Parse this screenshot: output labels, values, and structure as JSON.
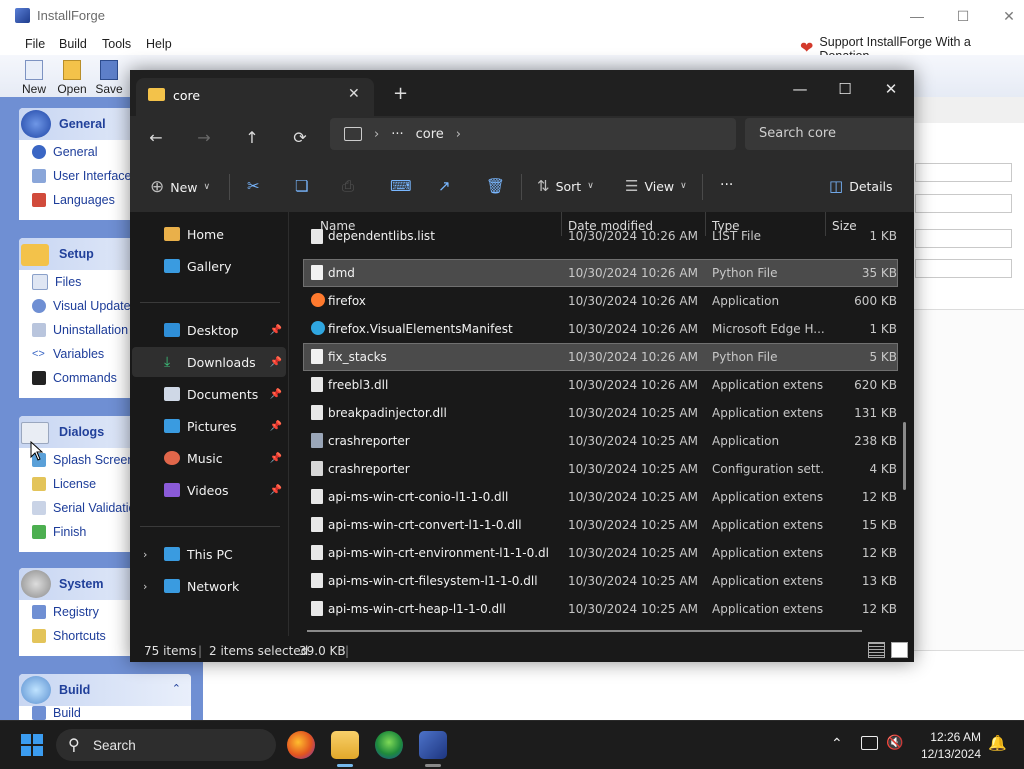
{
  "installforge": {
    "title": "InstallForge",
    "menu": [
      "File",
      "Build",
      "Tools",
      "Help"
    ],
    "donation": "Support InstallForge With a Donation",
    "toolbar": [
      "New",
      "Open",
      "Save"
    ],
    "groups": [
      {
        "title": "General",
        "items": [
          "General",
          "User Interface",
          "Languages"
        ]
      },
      {
        "title": "Setup",
        "items": [
          "Files",
          "Visual Update",
          "Uninstallation",
          "Variables",
          "Commands"
        ]
      },
      {
        "title": "Dialogs",
        "items": [
          "Splash Screen",
          "License",
          "Serial Validation",
          "Finish"
        ]
      },
      {
        "title": "System",
        "items": [
          "Registry",
          "Shortcuts"
        ]
      },
      {
        "title": "Build",
        "items": [
          "Build"
        ]
      }
    ]
  },
  "explorer": {
    "tab_title": "core",
    "address": {
      "ellipsis": "···",
      "folder": "core"
    },
    "search_placeholder": "Search core",
    "commands": {
      "new": "New",
      "sort": "Sort",
      "view": "View",
      "more": "···",
      "details": "Details"
    },
    "sidebar": {
      "home": "Home",
      "gallery": "Gallery",
      "pinned": [
        "Desktop",
        "Downloads",
        "Documents",
        "Pictures",
        "Music",
        "Videos"
      ],
      "this_pc": "This PC",
      "network": "Network"
    },
    "columns": {
      "name": "Name",
      "date": "Date modified",
      "type": "Type",
      "size": "Size"
    },
    "files": [
      {
        "name": "dependentlibs.list",
        "date": "10/30/2024 10:26 AM",
        "type": "LIST File",
        "size": "1 KB",
        "icon": "file-icon",
        "selected": false
      },
      {
        "name": "dmd",
        "date": "10/30/2024 10:26 AM",
        "type": "Python File",
        "size": "35 KB",
        "icon": "python-file-icon",
        "selected": true
      },
      {
        "name": "firefox",
        "date": "10/30/2024 10:26 AM",
        "type": "Application",
        "size": "600 KB",
        "icon": "firefox-icon",
        "selected": false
      },
      {
        "name": "firefox.VisualElementsManifest",
        "date": "10/30/2024 10:26 AM",
        "type": "Microsoft Edge H...",
        "size": "1 KB",
        "icon": "edge-icon",
        "selected": false
      },
      {
        "name": "fix_stacks",
        "date": "10/30/2024 10:26 AM",
        "type": "Python File",
        "size": "5 KB",
        "icon": "python-file-icon",
        "selected": true
      },
      {
        "name": "freebl3.dll",
        "date": "10/30/2024 10:26 AM",
        "type": "Application extens...",
        "size": "620 KB",
        "icon": "dll-icon",
        "selected": false
      },
      {
        "name": "breakpadinjector.dll",
        "date": "10/30/2024 10:25 AM",
        "type": "Application extens...",
        "size": "131 KB",
        "icon": "dll-icon",
        "selected": false
      },
      {
        "name": "crashreporter",
        "date": "10/30/2024 10:25 AM",
        "type": "Application",
        "size": "238 KB",
        "icon": "app-icon",
        "selected": false
      },
      {
        "name": "crashreporter",
        "date": "10/30/2024 10:25 AM",
        "type": "Configuration sett...",
        "size": "4 KB",
        "icon": "config-icon",
        "selected": false
      },
      {
        "name": "api-ms-win-crt-conio-l1-1-0.dll",
        "date": "10/30/2024 10:25 AM",
        "type": "Application extens...",
        "size": "12 KB",
        "icon": "dll-icon",
        "selected": false
      },
      {
        "name": "api-ms-win-crt-convert-l1-1-0.dll",
        "date": "10/30/2024 10:25 AM",
        "type": "Application extens...",
        "size": "15 KB",
        "icon": "dll-icon",
        "selected": false
      },
      {
        "name": "api-ms-win-crt-environment-l1-1-0.dll",
        "date": "10/30/2024 10:25 AM",
        "type": "Application extens...",
        "size": "12 KB",
        "icon": "dll-icon",
        "selected": false
      },
      {
        "name": "api-ms-win-crt-filesystem-l1-1-0.dll",
        "date": "10/30/2024 10:25 AM",
        "type": "Application extens...",
        "size": "13 KB",
        "icon": "dll-icon",
        "selected": false
      },
      {
        "name": "api-ms-win-crt-heap-l1-1-0.dll",
        "date": "10/30/2024 10:25 AM",
        "type": "Application extens...",
        "size": "12 KB",
        "icon": "dll-icon",
        "selected": false
      }
    ],
    "status": {
      "items": "75 items",
      "selected": "2 items selected",
      "size": "39.0 KB"
    }
  },
  "taskbar": {
    "search": "Search",
    "time": "12:26 AM",
    "date": "12/13/2024"
  },
  "colors": {
    "if_leftbar": "#6f8fd3",
    "explorer_bg": "#191919",
    "accent": "#3b9cf0"
  }
}
